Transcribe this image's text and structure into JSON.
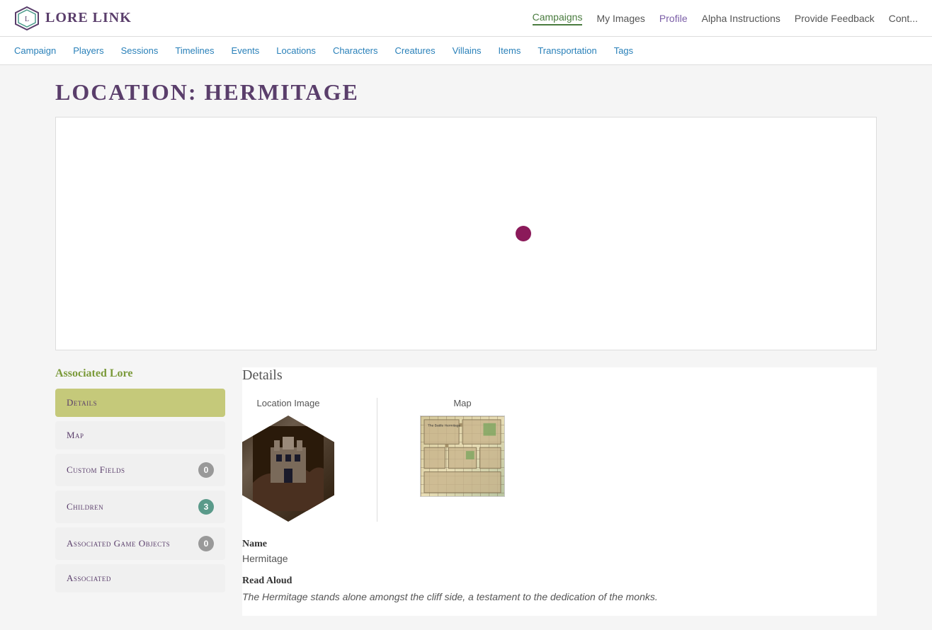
{
  "app": {
    "logo_text": "Lore Link"
  },
  "top_nav": {
    "links": [
      {
        "label": "Campaigns",
        "key": "campaigns",
        "active": true
      },
      {
        "label": "My Images",
        "key": "my-images",
        "active": false
      },
      {
        "label": "Profile",
        "key": "profile",
        "active": false
      },
      {
        "label": "Alpha Instructions",
        "key": "alpha",
        "active": false
      },
      {
        "label": "Provide Feedback",
        "key": "feedback",
        "active": false
      },
      {
        "label": "Cont...",
        "key": "cont",
        "active": false
      }
    ]
  },
  "second_nav": {
    "links": [
      {
        "label": "Campaign"
      },
      {
        "label": "Players"
      },
      {
        "label": "Sessions"
      },
      {
        "label": "Timelines"
      },
      {
        "label": "Events"
      },
      {
        "label": "Locations"
      },
      {
        "label": "Characters"
      },
      {
        "label": "Creatures"
      },
      {
        "label": "Villains"
      },
      {
        "label": "Items"
      },
      {
        "label": "Transportation"
      },
      {
        "label": "Tags"
      }
    ]
  },
  "page": {
    "title": "Location: Hermitage"
  },
  "sidebar": {
    "section_title": "Associated Lore",
    "items": [
      {
        "label": "Details",
        "key": "details",
        "active": true,
        "badge": null
      },
      {
        "label": "Map",
        "key": "map",
        "active": false,
        "badge": null
      },
      {
        "label": "Custom Fields",
        "key": "custom-fields",
        "active": false,
        "badge": "0"
      },
      {
        "label": "Children",
        "key": "children",
        "active": false,
        "badge": "3"
      },
      {
        "label": "Associated Game Objects",
        "key": "associated-game-objects",
        "active": false,
        "badge": "0"
      },
      {
        "label": "Associated",
        "key": "associated",
        "active": false,
        "badge": null
      }
    ]
  },
  "details": {
    "title": "Details",
    "location_image_label": "Location Image",
    "map_label": "Map",
    "name_label": "Name",
    "name_value": "Hermitage",
    "read_aloud_label": "Read Aloud",
    "read_aloud_value": "The Hermitage stands alone amongst the cliff side, a testament to the dedication of the monks."
  }
}
